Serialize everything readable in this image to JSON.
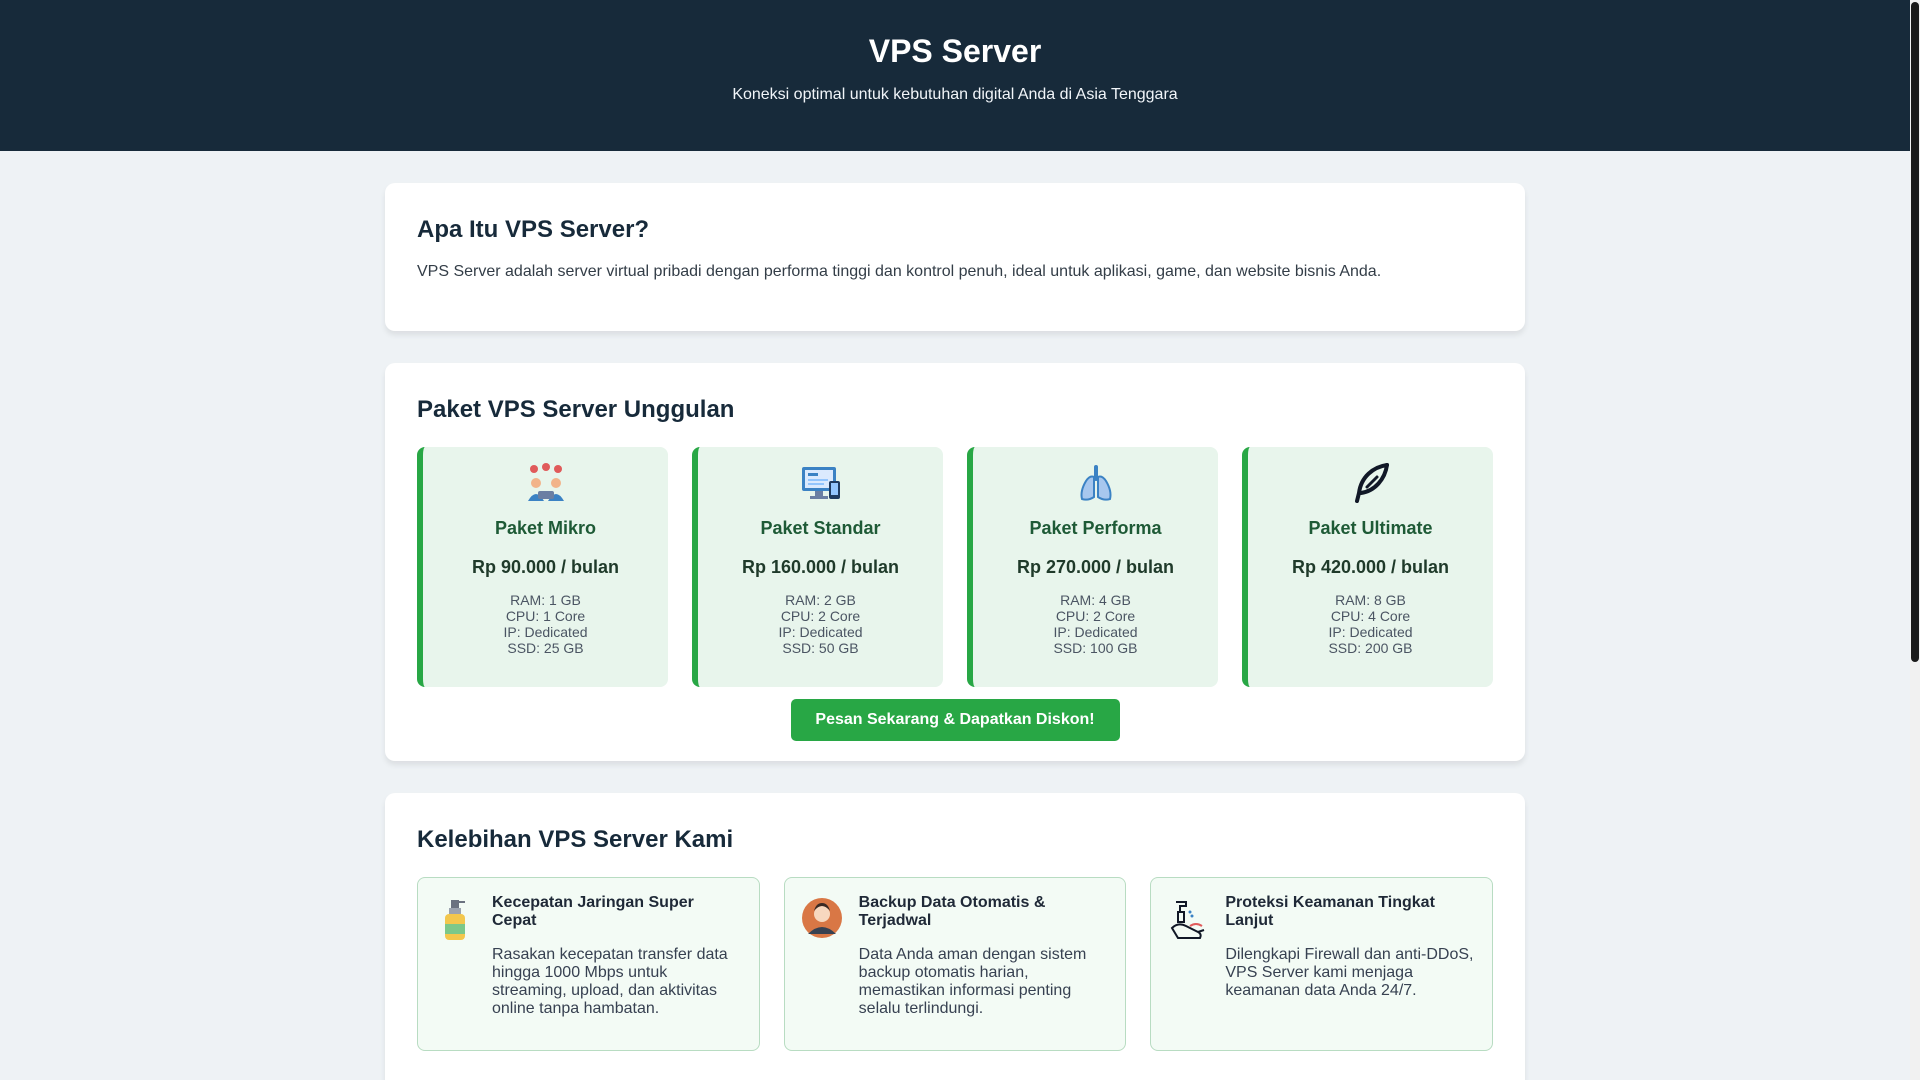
{
  "hero": {
    "title": "VPS Server",
    "subtitle": "Koneksi optimal untuk kebutuhan digital Anda di Asia Tenggara"
  },
  "about": {
    "heading": "Apa Itu VPS Server?",
    "text": "VPS Server adalah server virtual pribadi dengan performa tinggi dan kontrol penuh, ideal untuk aplikasi, game, dan website bisnis Anda."
  },
  "packages": {
    "heading": "Paket VPS Server Unggulan",
    "items": [
      {
        "icon": "team-icon",
        "name": "Paket Mikro",
        "price": "Rp 90.000 / bulan",
        "ram": "RAM: 1 GB",
        "cpu": "CPU: 1 Core",
        "ip": "IP: Dedicated",
        "ssd": "SSD: 25 GB"
      },
      {
        "icon": "computer-icon",
        "name": "Paket Standar",
        "price": "Rp 160.000 / bulan",
        "ram": "RAM: 2 GB",
        "cpu": "CPU: 2 Core",
        "ip": "IP: Dedicated",
        "ssd": "SSD: 50 GB"
      },
      {
        "icon": "lungs-icon",
        "name": "Paket Performa",
        "price": "Rp 270.000 / bulan",
        "ram": "RAM: 4 GB",
        "cpu": "CPU: 2 Core",
        "ip": "IP: Dedicated",
        "ssd": "SSD: 100 GB"
      },
      {
        "icon": "feather-icon",
        "name": "Paket Ultimate",
        "price": "Rp 420.000 / bulan",
        "ram": "RAM: 8 GB",
        "cpu": "CPU: 4 Core",
        "ip": "IP: Dedicated",
        "ssd": "SSD: 200 GB"
      }
    ],
    "order_label": "Pesan Sekarang & Dapatkan Diskon!"
  },
  "features": {
    "heading": "Kelebihan VPS Server Kami",
    "items": [
      {
        "icon": "spray-bottle-icon",
        "title": "Kecepatan Jaringan Super Cepat",
        "text": "Rasakan kecepatan transfer data hingga 1000 Mbps untuk streaming, upload, dan aktivitas online tanpa hambatan."
      },
      {
        "icon": "user-avatar-icon",
        "title": "Backup Data Otomatis & Terjadwal",
        "text": "Data Anda aman dengan sistem backup otomatis harian, memastikan informasi penting selalu terlindungi."
      },
      {
        "icon": "handwash-icon",
        "title": "Proteksi Keamanan Tingkat Lanjut",
        "text": "Dilengkapi Firewall dan anti-DDoS, VPS Server kami menjaga keamanan data Anda 24/7."
      }
    ]
  },
  "colors": {
    "header_bg": "#172a3a",
    "accent_green": "#28a745",
    "package_bg": "#e8f5ec"
  }
}
